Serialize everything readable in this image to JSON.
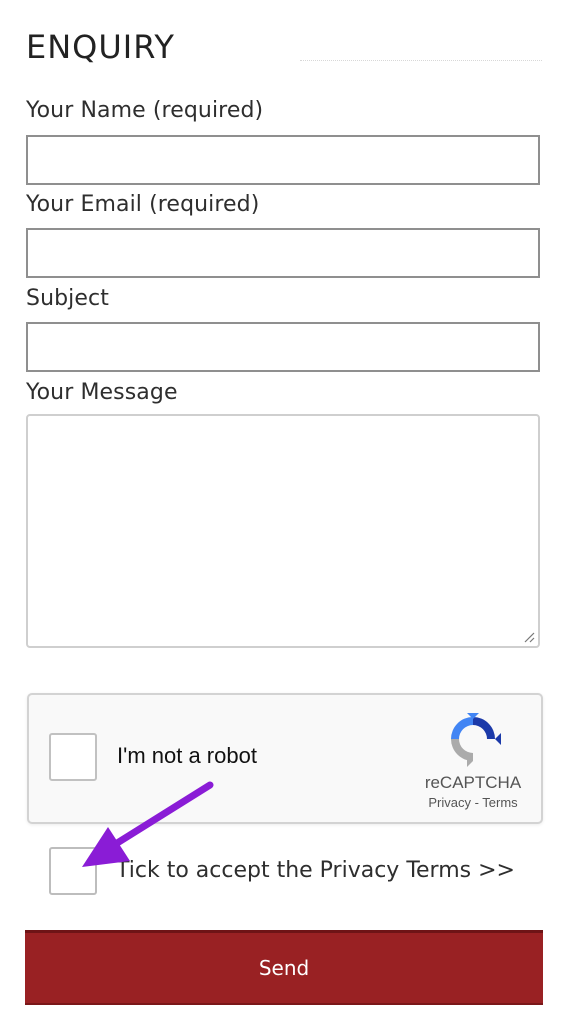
{
  "form": {
    "heading": "ENQUIRY",
    "fields": {
      "name_label": "Your Name (required)",
      "name_value": "",
      "email_label": "Your Email (required)",
      "email_value": "",
      "subject_label": "Subject",
      "subject_value": "",
      "message_label": "Your Message",
      "message_value": ""
    },
    "recaptcha": {
      "checkbox_label": "I'm not a robot",
      "brand": "reCAPTCHA",
      "privacy_link": "Privacy",
      "separator": " - ",
      "terms_link": "Terms",
      "checked": false,
      "logo_icon": "recaptcha-logo-icon"
    },
    "privacy": {
      "label": "Tick to accept the Privacy Terms >>",
      "checked": false
    },
    "send_label": "Send"
  },
  "annotation": {
    "arrow_icon": "purple-arrow-icon",
    "arrow_color": "#8a1cd6"
  },
  "colors": {
    "button_bg": "#992123",
    "text": "#2e2e2e",
    "field_border": "#8f8f8f"
  }
}
